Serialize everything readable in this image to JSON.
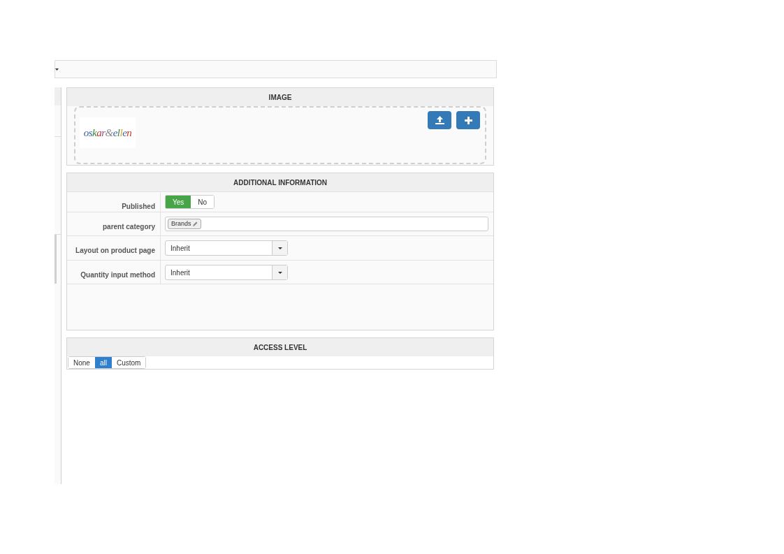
{
  "image_section": {
    "title": "IMAGE",
    "logo_text": "oskar&ellen",
    "buttons": [
      {
        "kind": "upload"
      },
      {
        "kind": "add"
      }
    ]
  },
  "additional_information": {
    "title": "ADDITIONAL INFORMATION",
    "published": {
      "label": "Published",
      "options": [
        {
          "label": "Yes",
          "selected": true
        },
        {
          "label": "No",
          "selected": false
        }
      ]
    },
    "parent_category": {
      "label": "parent category",
      "tags": [
        "Brands"
      ]
    },
    "selects": [
      {
        "label": "Layout on product page",
        "value": "Inherit"
      },
      {
        "label": "Quantity input method",
        "value": "Inherit"
      }
    ]
  },
  "access_level": {
    "title": "ACCESS LEVEL",
    "options": [
      {
        "label": "None",
        "selected": false
      },
      {
        "label": "all",
        "selected": true
      },
      {
        "label": "Custom",
        "selected": false
      }
    ]
  }
}
